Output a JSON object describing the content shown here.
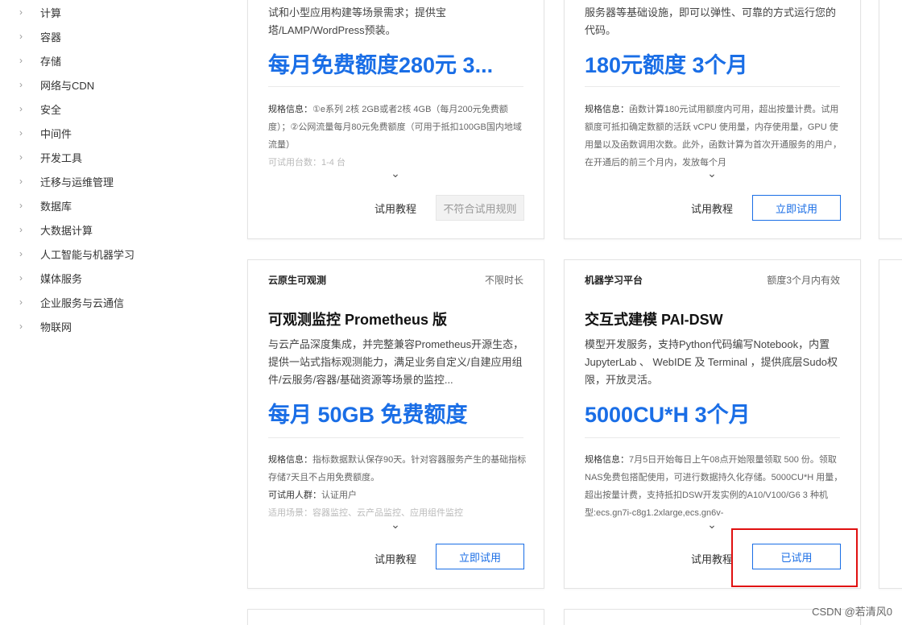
{
  "sidebar": {
    "items": [
      {
        "label": "计算"
      },
      {
        "label": "容器"
      },
      {
        "label": "存储"
      },
      {
        "label": "网络与CDN"
      },
      {
        "label": "安全"
      },
      {
        "label": "中间件"
      },
      {
        "label": "开发工具"
      },
      {
        "label": "迁移与运维管理"
      },
      {
        "label": "数据库"
      },
      {
        "label": "大数据计算"
      },
      {
        "label": "人工智能与机器学习"
      },
      {
        "label": "媒体服务"
      },
      {
        "label": "企业服务与云通信"
      },
      {
        "label": "物联网"
      }
    ],
    "chevron": "›"
  },
  "cards": [
    {
      "desc": "试和小型应用构建等场景需求；提供宝塔/LAMP/WordPress预装。",
      "price": "每月免费额度280元 3...",
      "specs_label": "规格信息：",
      "specs": "①e系列 2核 2GB或者2核 4GB（每月200元免费额度）；②公网流量每月80元免费额度（可用于抵扣100GB国内地域流量）",
      "extra_label": "可试用台数：",
      "extra": "1-4 台",
      "tutorial": "试用教程",
      "button": "不符合试用规则"
    },
    {
      "desc": "服务器等基础设施，即可以弹性、可靠的方式运行您的代码。",
      "price": "180元额度 3个月",
      "specs_label": "规格信息：",
      "specs": "函数计算180元试用额度内可用，超出按量计费。试用额度可抵扣确定数额的活跃 vCPU 使用量，内存使用量，GPU 使用量以及函数调用次数。此外，函数计算为首次开通服务的用户，在开通后的前三个月内，发放每个月",
      "tutorial": "试用教程",
      "button": "立即试用"
    },
    {
      "category": "云原生可观测",
      "duration": "不限时长",
      "title": "可观测监控 Prometheus 版",
      "desc": "与云产品深度集成，并完整兼容Prometheus开源生态，提供一站式指标观测能力，满足业务自定义/自建应用组件/云服务/容器/基础资源等场景的监控...",
      "price": "每月 50GB 免费额度",
      "specs_label": "规格信息：",
      "specs": "指标数据默认保存90天。针对容器服务产生的基础指标存储7天且不占用免费额度。",
      "users_label": "可试用人群：",
      "users": "认证用户",
      "scene_label": "适用场景：",
      "scene": "容器监控、云产品监控、应用组件监控",
      "tutorial": "试用教程",
      "button": "立即试用"
    },
    {
      "category": "机器学习平台",
      "duration": "额度3个月内有效",
      "title": "交互式建模 PAI-DSW",
      "desc": "模型开发服务，支持Python代码编写Notebook，内置 JupyterLab 、 WebIDE 及 Terminal ，提供底层Sudo权限，开放灵活。",
      "price": "5000CU*H 3个月",
      "specs_label": "规格信息：",
      "specs": "7月5日开始每日上午08点开始限量领取 500 份。领取NAS免费包搭配使用，可进行数据持久化存储。5000CU*H 用量，超出按量计费，支持抵扣DSW开发实例的A10/V100/G6 3 种机型:ecs.gn7i-c8g1.2xlarge,ecs.gn6v-",
      "tutorial": "试用教程",
      "button": "已试用"
    }
  ],
  "expand_icon": "⌄",
  "watermark": "CSDN @若清风0",
  "colors": {
    "accent": "#1a6ee6",
    "highlight": "#e01010"
  }
}
